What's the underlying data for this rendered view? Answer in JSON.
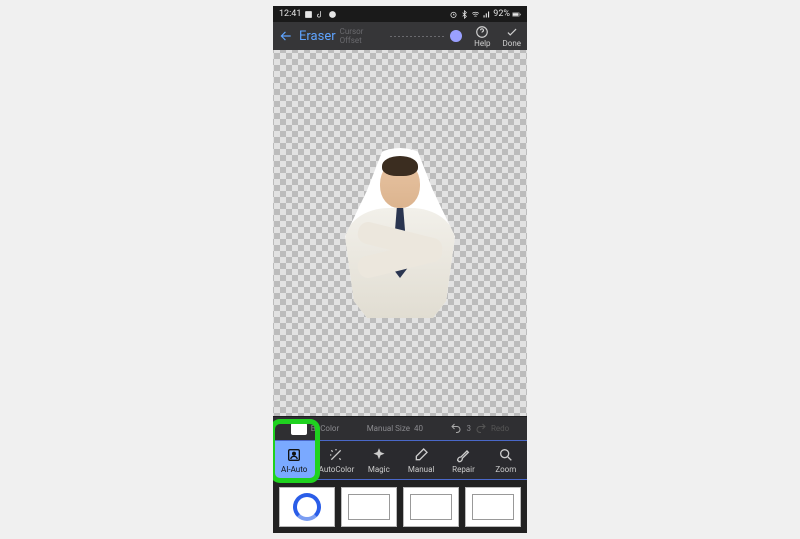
{
  "status": {
    "time": "12:41",
    "battery": "92%"
  },
  "header": {
    "title": "Eraser",
    "cursor_label": "Cursor Offset",
    "help": "Help",
    "done": "Done"
  },
  "upper": {
    "bgcolor": "BgColor",
    "manual_size_label": "Manual Size",
    "manual_size_value": "40",
    "undo_count": "3",
    "redo": "Redo"
  },
  "tools": {
    "ai_auto": "AI-Auto",
    "auto_color": "AutoColor",
    "magic": "Magic",
    "manual": "Manual",
    "repair": "Repair",
    "zoom": "Zoom"
  }
}
